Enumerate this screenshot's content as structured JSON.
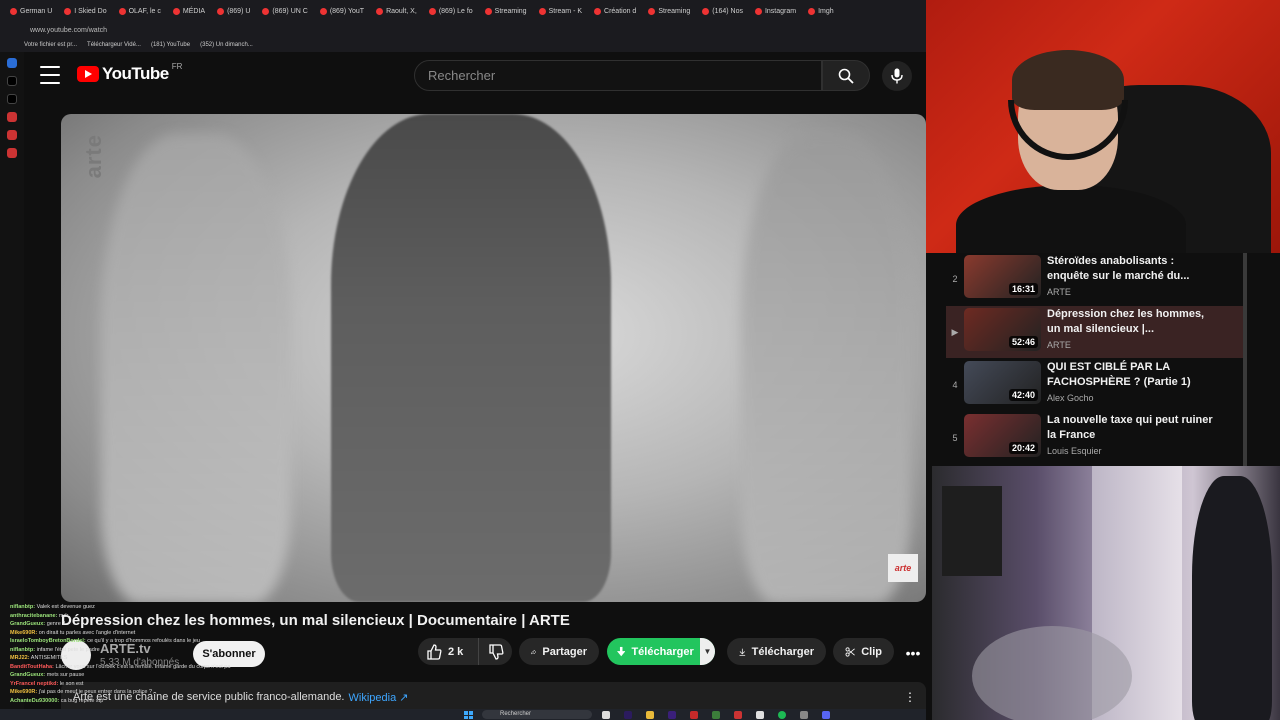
{
  "browser": {
    "tabs": [
      "German U",
      "I Skied Do",
      "OLAF, le c",
      "MÉDIA",
      "(869) U",
      "(869) UN C",
      "(869) YouT",
      "Raoult, X,",
      "(869) Le fo",
      "Streaming",
      "Stream - K",
      "Création d",
      "Streaming",
      "(164) Nos",
      "Instagram",
      "Imgh"
    ],
    "url": "www.youtube.com/watch",
    "bookmarks": [
      "Votre fichier est pr...",
      "Téléchargeur Vidé...",
      "(181) YouTube",
      "(352) Un dimanch..."
    ]
  },
  "youtube": {
    "logo_text": "YouTube",
    "country_code": "FR",
    "search_placeholder": "Rechercher"
  },
  "video": {
    "watermark": "arte",
    "corner_badge": "arte",
    "title": "Dépression chez les hommes, un mal silencieux | Documentaire | ARTE",
    "channel": "ARTE.tv",
    "subscribers": "5,33 M d'abonnés",
    "subscribe_label": "S'abonner",
    "likes": "2 k",
    "share_label": "Partager",
    "download_ext_label": "Télécharger",
    "download_label": "Télécharger",
    "clip_label": "Clip",
    "description": "Arte est une chaîne de service public franco-allemande.",
    "wiki_link": "Wikipedia ↗"
  },
  "playlist": [
    {
      "index": "2",
      "title": "Stéroïdes anabolisants : enquête sur le marché du...",
      "channel": "ARTE",
      "duration": "16:31",
      "thumb_color": "#8a3a2e",
      "active": false
    },
    {
      "index": "▶",
      "title": "Dépression chez les hommes, un mal silencieux |...",
      "channel": "ARTE",
      "duration": "52:46",
      "thumb_color": "#6e2a22",
      "active": true
    },
    {
      "index": "4",
      "title": "QUI EST CIBLÉ PAR LA FACHOSPHÈRE ? (Partie 1)",
      "channel": "Alex Gocho",
      "duration": "42:40",
      "thumb_color": "#444a58",
      "active": false
    },
    {
      "index": "5",
      "title": "La nouvelle taxe qui peut ruiner la France",
      "channel": "Louis Esquier",
      "duration": "20:42",
      "thumb_color": "#7a2f30",
      "active": false
    }
  ],
  "chat": [
    {
      "user": "niflanbtp:",
      "msg": "Valek est devenue guez",
      "c": "g"
    },
    {
      "user": "anthracitebanane:",
      "msg": "mdr",
      "c": "g"
    },
    {
      "user": "GrandGueux:",
      "msg": "genre 2",
      "c": "g"
    },
    {
      "user": "Mike690R:",
      "msg": "on dirait tu parles avec l'angle d'internet",
      "c": "y"
    },
    {
      "user": "IsraeloTomboyBretonBordel:",
      "msg": "ce qu'il y a trop d'hommos refoulés dans le jeu",
      "c": "g"
    },
    {
      "user": "niflanbtp:",
      "msg": "infame l'état pete le padre",
      "c": "g"
    },
    {
      "user": "MRJ22:",
      "msg": "ANTISEMITES",
      "c": "y"
    },
    {
      "user": "BanditToutHaha:",
      "msg": "Lâcher vous sur l'ourbek c'est la remise. Infame garde du corps n'est pa",
      "c": "r"
    },
    {
      "user": "GrandGueux:",
      "msg": "mets sur pause",
      "c": "g"
    },
    {
      "user": "YrFrancel neptikd:",
      "msg": "le son est",
      "c": "r"
    },
    {
      "user": "Mike690R:",
      "msg": "j'ai pas de meuf je peux entrer dans la police ?",
      "c": "y"
    },
    {
      "user": "AchanteDu930000:",
      "msg": "ca bug repete stp",
      "c": "g"
    }
  ],
  "taskbar": {
    "search_label": "Rechercher"
  },
  "colors": {
    "bg": "#0f0f0f",
    "brand": "#ff0000",
    "download_green": "#22c55e",
    "link": "#3ea6ff"
  }
}
